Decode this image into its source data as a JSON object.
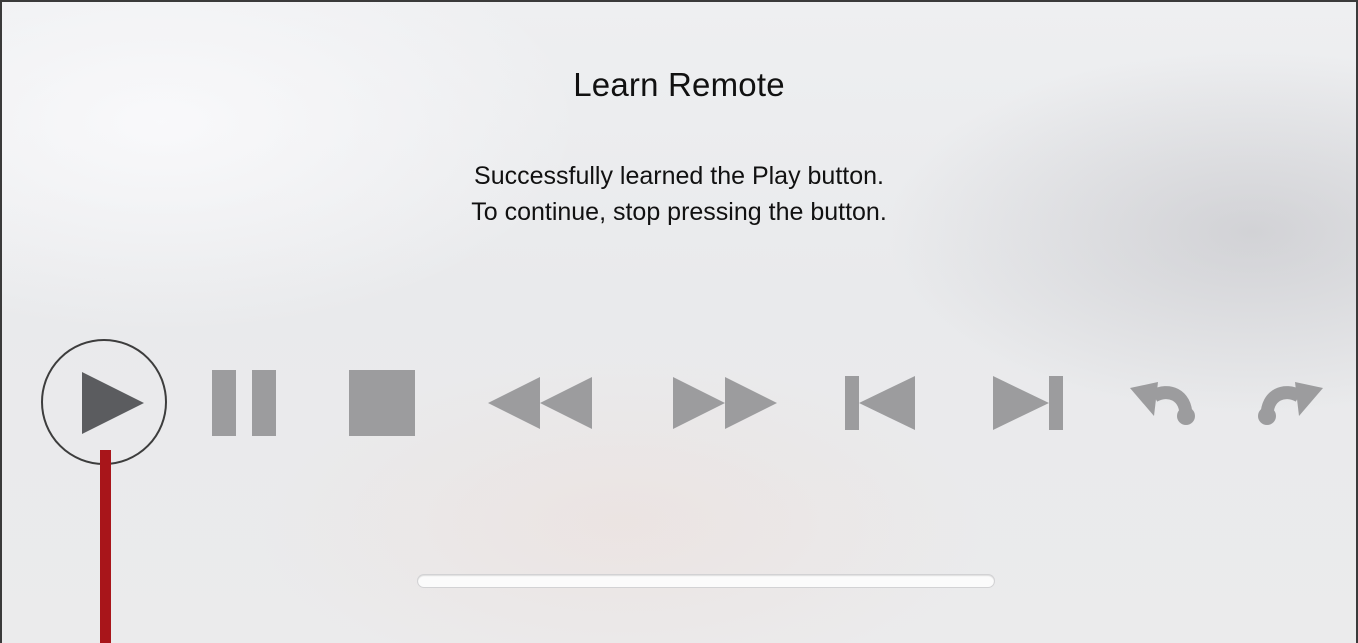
{
  "screen": {
    "title": "Learn Remote",
    "message_line1": "Successfully learned the Play button.",
    "message_line2": "To continue, stop pressing the button."
  },
  "controls": [
    {
      "name": "play",
      "icon": "play-icon",
      "selected": true
    },
    {
      "name": "pause",
      "icon": "pause-icon",
      "selected": false
    },
    {
      "name": "stop",
      "icon": "stop-icon",
      "selected": false
    },
    {
      "name": "rewind",
      "icon": "rewind-icon",
      "selected": false
    },
    {
      "name": "fast-forward",
      "icon": "fast-forward-icon",
      "selected": false
    },
    {
      "name": "previous",
      "icon": "skip-back-icon",
      "selected": false
    },
    {
      "name": "next",
      "icon": "skip-forward-icon",
      "selected": false
    },
    {
      "name": "skip-back",
      "icon": "undo-icon",
      "selected": false
    },
    {
      "name": "skip-forward",
      "icon": "redo-icon",
      "selected": false
    }
  ],
  "colors": {
    "selected_icon": "#5b5c5f",
    "inactive_icon": "#9c9c9e",
    "callout": "#a8151a",
    "text": "#111111"
  }
}
